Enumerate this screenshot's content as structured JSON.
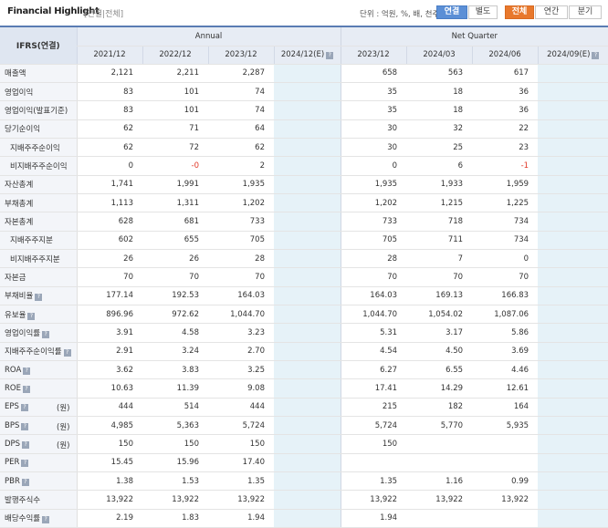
{
  "header": {
    "title": "Financial Highlight",
    "subtitle": "[연결|전체]",
    "unit_text": "단위 : 억원, %, 배, 천주",
    "scope_buttons": [
      "연결",
      "별도"
    ],
    "period_buttons": [
      "전체",
      "연간",
      "분기"
    ]
  },
  "table": {
    "corner_label": "IFRS(연결)",
    "groups": [
      "Annual",
      "Net Quarter"
    ],
    "annual_cols": [
      "2021/12",
      "2022/12",
      "2023/12",
      "2024/12(E)"
    ],
    "quarter_cols": [
      "2023/12",
      "2024/03",
      "2024/06",
      "2024/09(E)"
    ],
    "rows": [
      {
        "label": "매출액",
        "vals": [
          "2,121",
          "2,211",
          "2,287",
          "",
          "658",
          "563",
          "617",
          ""
        ]
      },
      {
        "label": "영업이익",
        "vals": [
          "83",
          "101",
          "74",
          "",
          "35",
          "18",
          "36",
          ""
        ]
      },
      {
        "label": "영업이익(발표기준)",
        "vals": [
          "83",
          "101",
          "74",
          "",
          "35",
          "18",
          "36",
          ""
        ]
      },
      {
        "label": "당기순이익",
        "vals": [
          "62",
          "71",
          "64",
          "",
          "30",
          "32",
          "22",
          ""
        ]
      },
      {
        "label": "지배주주순이익",
        "indent": true,
        "vals": [
          "62",
          "72",
          "62",
          "",
          "30",
          "25",
          "23",
          ""
        ]
      },
      {
        "label": "비지배주주순이익",
        "indent": true,
        "vals": [
          "0",
          "-0",
          "2",
          "",
          "0",
          "6",
          "-1",
          ""
        ]
      },
      {
        "label": "자산총계",
        "vals": [
          "1,741",
          "1,991",
          "1,935",
          "",
          "1,935",
          "1,933",
          "1,959",
          ""
        ]
      },
      {
        "label": "부채총계",
        "vals": [
          "1,113",
          "1,311",
          "1,202",
          "",
          "1,202",
          "1,215",
          "1,225",
          ""
        ]
      },
      {
        "label": "자본총계",
        "vals": [
          "628",
          "681",
          "733",
          "",
          "733",
          "718",
          "734",
          ""
        ]
      },
      {
        "label": "지배주주지분",
        "indent": true,
        "vals": [
          "602",
          "655",
          "705",
          "",
          "705",
          "711",
          "734",
          ""
        ]
      },
      {
        "label": "비지배주주지분",
        "indent": true,
        "vals": [
          "26",
          "26",
          "28",
          "",
          "28",
          "7",
          "0",
          ""
        ]
      },
      {
        "label": "자본금",
        "vals": [
          "70",
          "70",
          "70",
          "",
          "70",
          "70",
          "70",
          ""
        ]
      },
      {
        "label": "부채비율",
        "info": true,
        "vals": [
          "177.14",
          "192.53",
          "164.03",
          "",
          "164.03",
          "169.13",
          "166.83",
          ""
        ]
      },
      {
        "label": "유보율",
        "info": true,
        "vals": [
          "896.96",
          "972.62",
          "1,044.70",
          "",
          "1,044.70",
          "1,054.02",
          "1,087.06",
          ""
        ]
      },
      {
        "label": "영업이익률",
        "info": true,
        "vals": [
          "3.91",
          "4.58",
          "3.23",
          "",
          "5.31",
          "3.17",
          "5.86",
          ""
        ]
      },
      {
        "label": "지배주주순이익률",
        "info": true,
        "vals": [
          "2.91",
          "3.24",
          "2.70",
          "",
          "4.54",
          "4.50",
          "3.69",
          ""
        ]
      },
      {
        "label": "ROA",
        "info": true,
        "vals": [
          "3.62",
          "3.83",
          "3.25",
          "",
          "6.27",
          "6.55",
          "4.46",
          ""
        ]
      },
      {
        "label": "ROE",
        "info": true,
        "vals": [
          "10.63",
          "11.39",
          "9.08",
          "",
          "17.41",
          "14.29",
          "12.61",
          ""
        ]
      },
      {
        "label": "EPS",
        "info": true,
        "unit": "(원)",
        "vals": [
          "444",
          "514",
          "444",
          "",
          "215",
          "182",
          "164",
          ""
        ]
      },
      {
        "label": "BPS",
        "info": true,
        "unit": "(원)",
        "vals": [
          "4,985",
          "5,363",
          "5,724",
          "",
          "5,724",
          "5,770",
          "5,935",
          ""
        ]
      },
      {
        "label": "DPS",
        "info": true,
        "unit": "(원)",
        "vals": [
          "150",
          "150",
          "150",
          "",
          "150",
          "",
          "",
          ""
        ]
      },
      {
        "label": "PER",
        "info": true,
        "vals": [
          "15.45",
          "15.96",
          "17.40",
          "",
          "",
          "",
          "",
          ""
        ]
      },
      {
        "label": "PBR",
        "info": true,
        "vals": [
          "1.38",
          "1.53",
          "1.35",
          "",
          "1.35",
          "1.16",
          "0.99",
          ""
        ]
      },
      {
        "label": "발행주식수",
        "vals": [
          "13,922",
          "13,922",
          "13,922",
          "",
          "13,922",
          "13,922",
          "13,922",
          ""
        ]
      },
      {
        "label": "배당수익률",
        "info": true,
        "vals": [
          "2.19",
          "1.83",
          "1.94",
          "",
          "1.94",
          "",
          "",
          ""
        ]
      }
    ]
  },
  "colors": {
    "header_border": "#5a7cb3",
    "estimate_bg": "#e6f2f8",
    "negative": "#e23a2a",
    "active_scope": "#5b8fd6",
    "active_period": "#e8782c"
  }
}
